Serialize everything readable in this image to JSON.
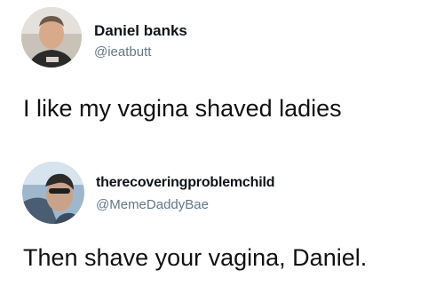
{
  "posts": [
    {
      "display_name": "Daniel banks",
      "handle": "@ieatbutt",
      "text": "I like my vagina shaved ladies",
      "avatar_icon": "user-avatar-photo"
    },
    {
      "display_name": "therecoveringproblemchild",
      "handle": "@MemeDaddyBae",
      "text": "Then shave your vagina, Daniel.",
      "avatar_icon": "user-avatar-photo"
    }
  ]
}
